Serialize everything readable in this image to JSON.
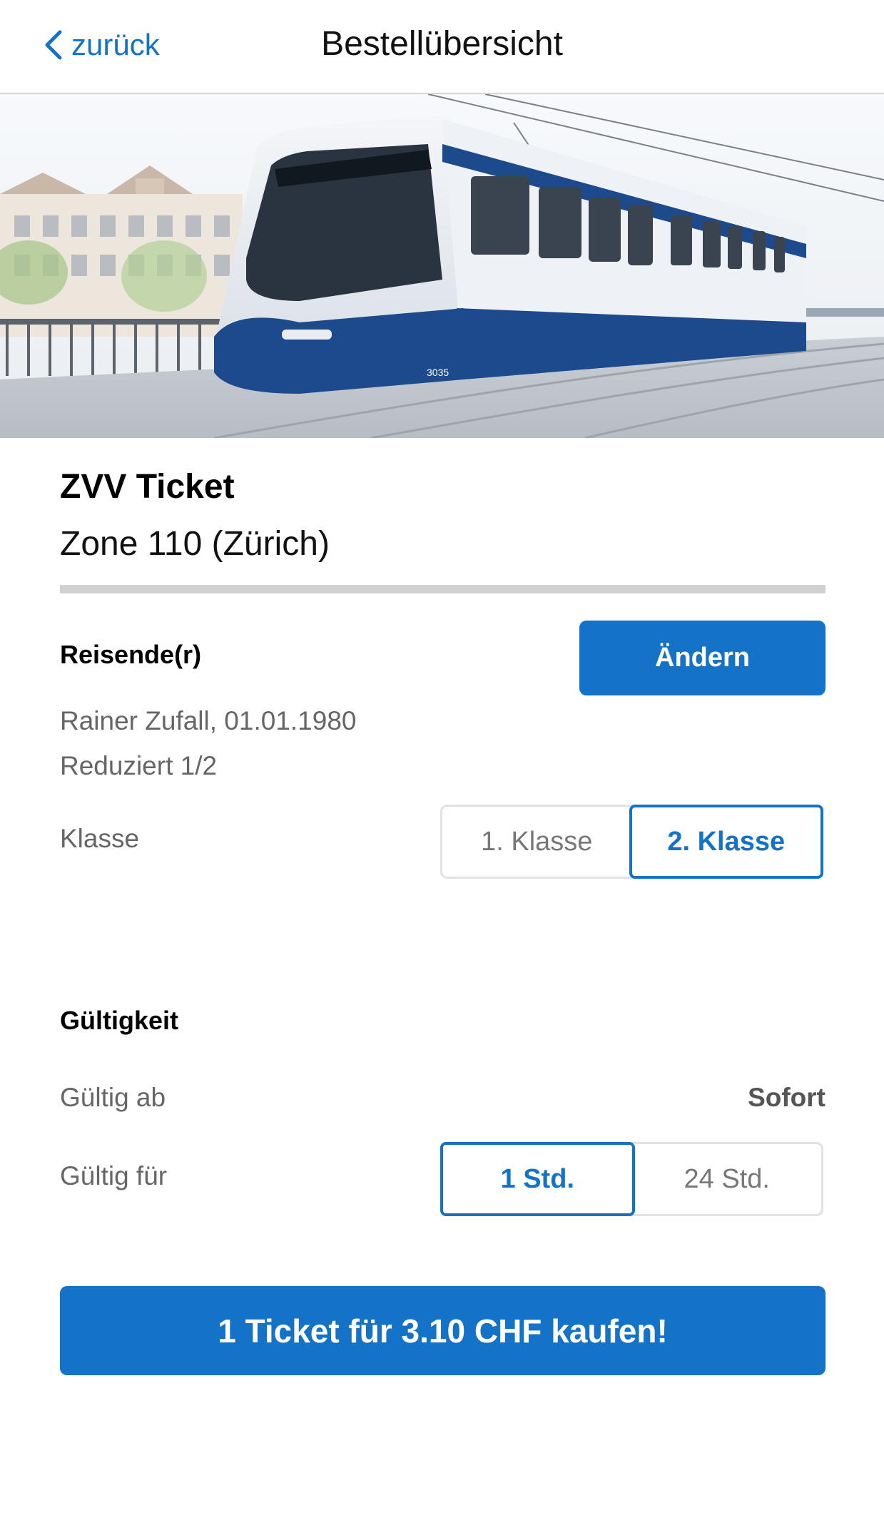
{
  "nav": {
    "back_label": "zurück",
    "title": "Bestellübersicht"
  },
  "ticket": {
    "title": "ZVV Ticket",
    "zone": "Zone 110 (Zürich)"
  },
  "traveler": {
    "section_title": "Reisende(r)",
    "change_button": "Ändern",
    "name": "Rainer Zufall, 01.01.1980",
    "fare": "Reduziert 1/2"
  },
  "klasse": {
    "label": "Klasse",
    "options": [
      "1. Klasse",
      "2. Klasse"
    ],
    "selected": "2. Klasse"
  },
  "gueltigkeit": {
    "section_title": "Gültigkeit",
    "valid_from_label": "Gültig ab",
    "valid_from_value": "Sofort",
    "valid_for_label": "Gültig für",
    "duration_options": [
      "1 Std.",
      "24 Std."
    ],
    "selected_duration": "1 Std."
  },
  "purchase": {
    "button_label": "1 Ticket für 3.10 CHF kaufen!"
  },
  "colors": {
    "accent": "#1473c6",
    "divider": "#d0d1d3",
    "muted_text": "#666666"
  },
  "icons": {
    "back": "chevron-left-icon",
    "hero": "tram-photo"
  },
  "hero_tram_number": "3035"
}
